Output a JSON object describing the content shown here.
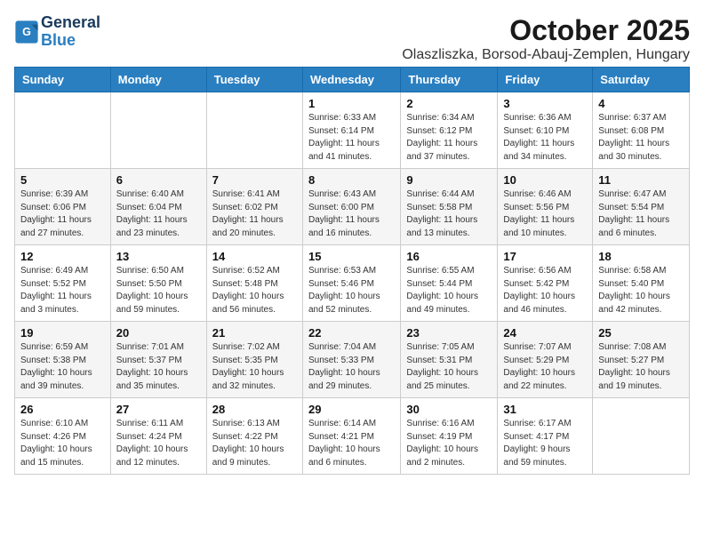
{
  "logo": {
    "line1": "General",
    "line2": "Blue"
  },
  "title": "October 2025",
  "subtitle": "Olaszliszka, Borsod-Abauj-Zemplen, Hungary",
  "headers": [
    "Sunday",
    "Monday",
    "Tuesday",
    "Wednesday",
    "Thursday",
    "Friday",
    "Saturday"
  ],
  "weeks": [
    [
      {
        "day": "",
        "info": ""
      },
      {
        "day": "",
        "info": ""
      },
      {
        "day": "",
        "info": ""
      },
      {
        "day": "1",
        "info": "Sunrise: 6:33 AM\nSunset: 6:14 PM\nDaylight: 11 hours\nand 41 minutes."
      },
      {
        "day": "2",
        "info": "Sunrise: 6:34 AM\nSunset: 6:12 PM\nDaylight: 11 hours\nand 37 minutes."
      },
      {
        "day": "3",
        "info": "Sunrise: 6:36 AM\nSunset: 6:10 PM\nDaylight: 11 hours\nand 34 minutes."
      },
      {
        "day": "4",
        "info": "Sunrise: 6:37 AM\nSunset: 6:08 PM\nDaylight: 11 hours\nand 30 minutes."
      }
    ],
    [
      {
        "day": "5",
        "info": "Sunrise: 6:39 AM\nSunset: 6:06 PM\nDaylight: 11 hours\nand 27 minutes."
      },
      {
        "day": "6",
        "info": "Sunrise: 6:40 AM\nSunset: 6:04 PM\nDaylight: 11 hours\nand 23 minutes."
      },
      {
        "day": "7",
        "info": "Sunrise: 6:41 AM\nSunset: 6:02 PM\nDaylight: 11 hours\nand 20 minutes."
      },
      {
        "day": "8",
        "info": "Sunrise: 6:43 AM\nSunset: 6:00 PM\nDaylight: 11 hours\nand 16 minutes."
      },
      {
        "day": "9",
        "info": "Sunrise: 6:44 AM\nSunset: 5:58 PM\nDaylight: 11 hours\nand 13 minutes."
      },
      {
        "day": "10",
        "info": "Sunrise: 6:46 AM\nSunset: 5:56 PM\nDaylight: 11 hours\nand 10 minutes."
      },
      {
        "day": "11",
        "info": "Sunrise: 6:47 AM\nSunset: 5:54 PM\nDaylight: 11 hours\nand 6 minutes."
      }
    ],
    [
      {
        "day": "12",
        "info": "Sunrise: 6:49 AM\nSunset: 5:52 PM\nDaylight: 11 hours\nand 3 minutes."
      },
      {
        "day": "13",
        "info": "Sunrise: 6:50 AM\nSunset: 5:50 PM\nDaylight: 10 hours\nand 59 minutes."
      },
      {
        "day": "14",
        "info": "Sunrise: 6:52 AM\nSunset: 5:48 PM\nDaylight: 10 hours\nand 56 minutes."
      },
      {
        "day": "15",
        "info": "Sunrise: 6:53 AM\nSunset: 5:46 PM\nDaylight: 10 hours\nand 52 minutes."
      },
      {
        "day": "16",
        "info": "Sunrise: 6:55 AM\nSunset: 5:44 PM\nDaylight: 10 hours\nand 49 minutes."
      },
      {
        "day": "17",
        "info": "Sunrise: 6:56 AM\nSunset: 5:42 PM\nDaylight: 10 hours\nand 46 minutes."
      },
      {
        "day": "18",
        "info": "Sunrise: 6:58 AM\nSunset: 5:40 PM\nDaylight: 10 hours\nand 42 minutes."
      }
    ],
    [
      {
        "day": "19",
        "info": "Sunrise: 6:59 AM\nSunset: 5:38 PM\nDaylight: 10 hours\nand 39 minutes."
      },
      {
        "day": "20",
        "info": "Sunrise: 7:01 AM\nSunset: 5:37 PM\nDaylight: 10 hours\nand 35 minutes."
      },
      {
        "day": "21",
        "info": "Sunrise: 7:02 AM\nSunset: 5:35 PM\nDaylight: 10 hours\nand 32 minutes."
      },
      {
        "day": "22",
        "info": "Sunrise: 7:04 AM\nSunset: 5:33 PM\nDaylight: 10 hours\nand 29 minutes."
      },
      {
        "day": "23",
        "info": "Sunrise: 7:05 AM\nSunset: 5:31 PM\nDaylight: 10 hours\nand 25 minutes."
      },
      {
        "day": "24",
        "info": "Sunrise: 7:07 AM\nSunset: 5:29 PM\nDaylight: 10 hours\nand 22 minutes."
      },
      {
        "day": "25",
        "info": "Sunrise: 7:08 AM\nSunset: 5:27 PM\nDaylight: 10 hours\nand 19 minutes."
      }
    ],
    [
      {
        "day": "26",
        "info": "Sunrise: 6:10 AM\nSunset: 4:26 PM\nDaylight: 10 hours\nand 15 minutes."
      },
      {
        "day": "27",
        "info": "Sunrise: 6:11 AM\nSunset: 4:24 PM\nDaylight: 10 hours\nand 12 minutes."
      },
      {
        "day": "28",
        "info": "Sunrise: 6:13 AM\nSunset: 4:22 PM\nDaylight: 10 hours\nand 9 minutes."
      },
      {
        "day": "29",
        "info": "Sunrise: 6:14 AM\nSunset: 4:21 PM\nDaylight: 10 hours\nand 6 minutes."
      },
      {
        "day": "30",
        "info": "Sunrise: 6:16 AM\nSunset: 4:19 PM\nDaylight: 10 hours\nand 2 minutes."
      },
      {
        "day": "31",
        "info": "Sunrise: 6:17 AM\nSunset: 4:17 PM\nDaylight: 9 hours\nand 59 minutes."
      },
      {
        "day": "",
        "info": ""
      }
    ]
  ]
}
